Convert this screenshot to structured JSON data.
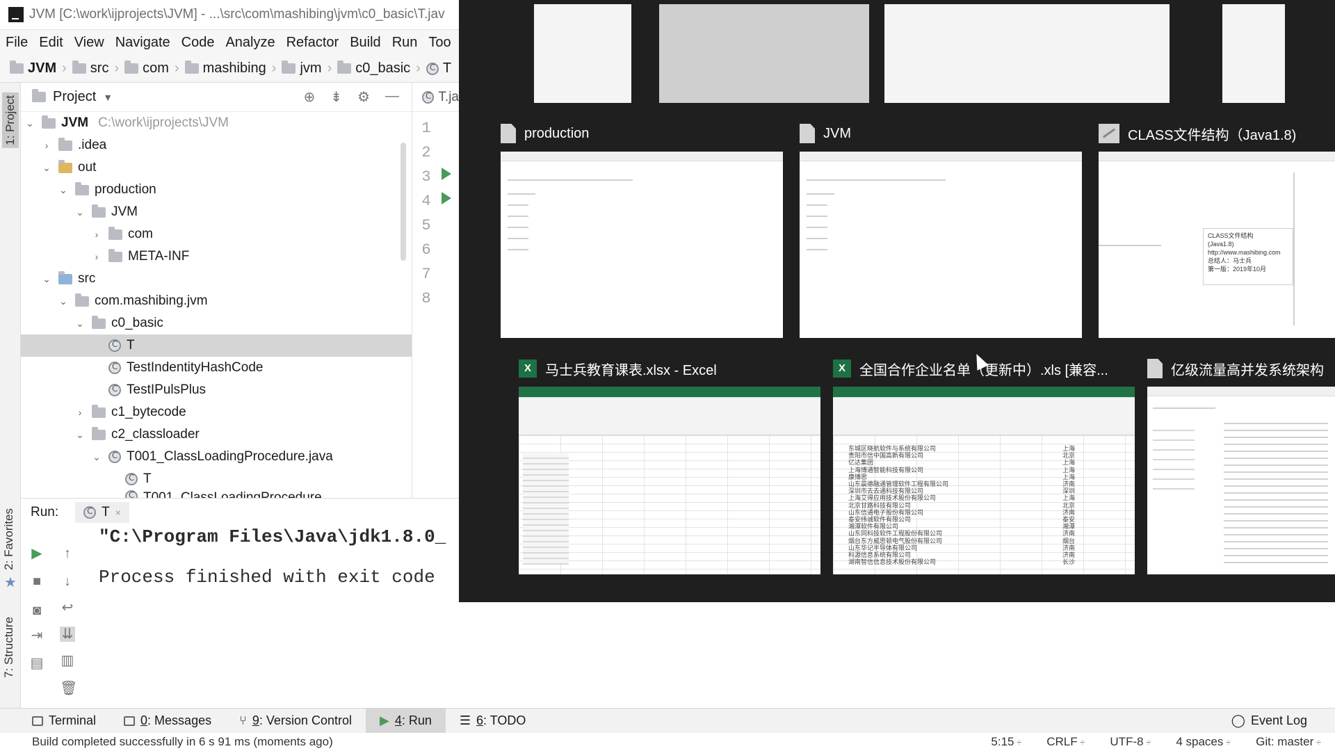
{
  "ide": {
    "window_title": "JVM [C:\\work\\ijprojects\\JVM] - ...\\src\\com\\mashibing\\jvm\\c0_basic\\T.jav",
    "menu": [
      "File",
      "Edit",
      "View",
      "Navigate",
      "Code",
      "Analyze",
      "Refactor",
      "Build",
      "Run",
      "Too"
    ],
    "breadcrumb": [
      "JVM",
      "src",
      "com",
      "mashibing",
      "jvm",
      "c0_basic",
      "T"
    ],
    "left_tabs": {
      "project": "1: Project",
      "favorites": "2: Favorites",
      "structure": "7: Structure"
    },
    "project_panel": {
      "title": "Project",
      "root_name": "JVM",
      "root_path": "C:\\work\\ijprojects\\JVM",
      "items": [
        ".idea",
        "out",
        "production",
        "JVM",
        "com",
        "META-INF",
        "src",
        "com.mashibing.jvm",
        "c0_basic",
        "T",
        "TestIndentityHashCode",
        "TestIPulsPlus",
        "c1_bytecode",
        "c2_classloader",
        "T001_ClassLoadingProcedure.java",
        "T",
        "T001_ClassLoadingProcedure"
      ]
    },
    "editor": {
      "tab": "T.ja",
      "line_numbers": [
        "1",
        "2",
        "3",
        "4",
        "5",
        "6",
        "7",
        "8"
      ]
    },
    "run_panel": {
      "label": "Run:",
      "tab": "T",
      "console_line1": "\"C:\\Program Files\\Java\\jdk1.8.0_",
      "console_line2": "Process finished with exit code"
    },
    "bottom_tabs": [
      {
        "num": "",
        "rest": "Terminal"
      },
      {
        "num": "0",
        "rest": ": Messages"
      },
      {
        "num": "9",
        "rest": ": Version Control"
      },
      {
        "num": "4",
        "rest": ": Run"
      },
      {
        "num": "6",
        "rest": ": TODO"
      }
    ],
    "event_log": "Event Log",
    "status": {
      "message": "Build completed successfully in 6 s 91 ms (moments ago)",
      "position": "5:15",
      "line_sep": "CRLF",
      "encoding": "UTF-8",
      "indent": "4 spaces",
      "vcs": "Git: master"
    }
  },
  "switcher": {
    "windows": [
      {
        "title": "production"
      },
      {
        "title": "JVM"
      },
      {
        "title": "CLASS文件结构（Java1.8)"
      },
      {
        "title": "马士兵教育课表.xlsx - Excel"
      },
      {
        "title": "全国合作企业名单（更新中）.xls [兼容..."
      },
      {
        "title": "亿级流量高并发系统架构"
      }
    ],
    "class_card": [
      "CLASS文件结构",
      "(Java1.8)",
      "http://www.mashibing.com",
      "总结人：马士兵",
      "第一版：2019年10月"
    ],
    "excel_rows": [
      "东城区晓航软件与系统有限公司",
      "贵阳市信中国高新有限公司",
      "亿达集团",
      "上海博通智能科技有限公司",
      "康博思",
      "山东晨德融通管理软件工程有限公司",
      "深圳市去去通科技有限公司",
      "上海艾得应用技术股份有限公司",
      "北京甘路科技有限公司",
      "山东信通电子股份有限公司",
      "泰安纬诚软件有限公司",
      "湘潭软件有限公司",
      "山东同科技软件工程股份有限公司",
      "烟台东方威思顿电气股份有限公司",
      "山东华记半导体有限公司",
      "科源信息系统有限公司",
      "湖南智信信息技术股份有限公司"
    ],
    "excel_cities": [
      "上海",
      "北京",
      "上海",
      "上海",
      "上海",
      "济南",
      "深圳",
      "上海",
      "北京",
      "济南",
      "泰安",
      "湘潭",
      "济南",
      "烟台",
      "济南",
      "济南",
      "长沙"
    ]
  },
  "colors": {
    "switcher_bg": "#1f1f1f",
    "excel_green": "#217346",
    "run_green": "#4a9a5a"
  }
}
